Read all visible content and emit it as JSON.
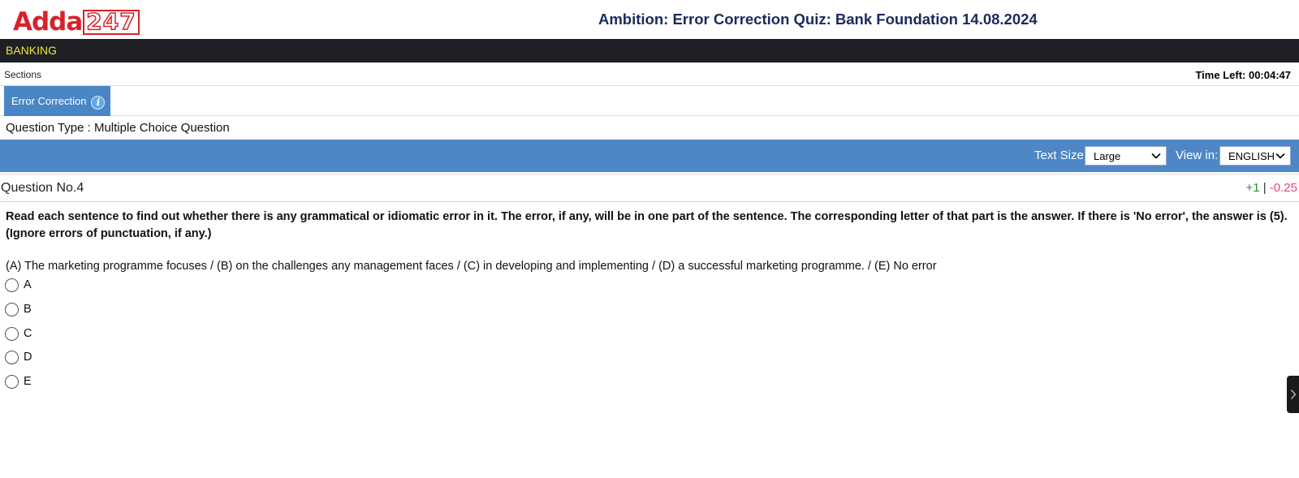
{
  "header": {
    "logo_text_a": "Adda",
    "logo_text_b": "247",
    "title": "Ambition: Error Correction Quiz: Bank Foundation 14.08.2024"
  },
  "topbar": {
    "label": "BANKING"
  },
  "sections_bar": {
    "label": "Sections",
    "time_left": "Time Left: 00:04:47"
  },
  "section_tab": {
    "label": "Error Correction",
    "info_icon": "i"
  },
  "question_type": "Question Type : Multiple Choice Question",
  "toolbar": {
    "text_size_label": "Text Size:",
    "text_size_value": "Large",
    "view_in_label": "View in:",
    "view_in_value": "ENGLISH"
  },
  "question": {
    "number": "Question No.4",
    "marks_positive": "+1",
    "marks_separator": "|",
    "marks_negative": "-0.25",
    "instructions": "Read each sentence to find out whether there is any grammatical or idiomatic error in it. The error, if any, will be in one part of the sentence. The corresponding letter of that part is the answer. If there is 'No error', the answer is (5). (Ignore errors of punctuation, if any.)",
    "text": "(A) The marketing programme focuses / (B) on the challenges any management faces / (C) in developing and implementing / (D) a successful marketing programme. / (E) No error",
    "options": [
      "A",
      "B",
      "C",
      "D",
      "E"
    ]
  },
  "colors": {
    "brand_red": "#d8222a",
    "topbar_bg": "#1f2026",
    "topbar_text": "#f2e33d",
    "tab_blue": "#4a86c5",
    "toolbar_blue": "#4f87c6",
    "positive_mark": "#2e8b2e",
    "negative_mark": "#e0457b"
  }
}
